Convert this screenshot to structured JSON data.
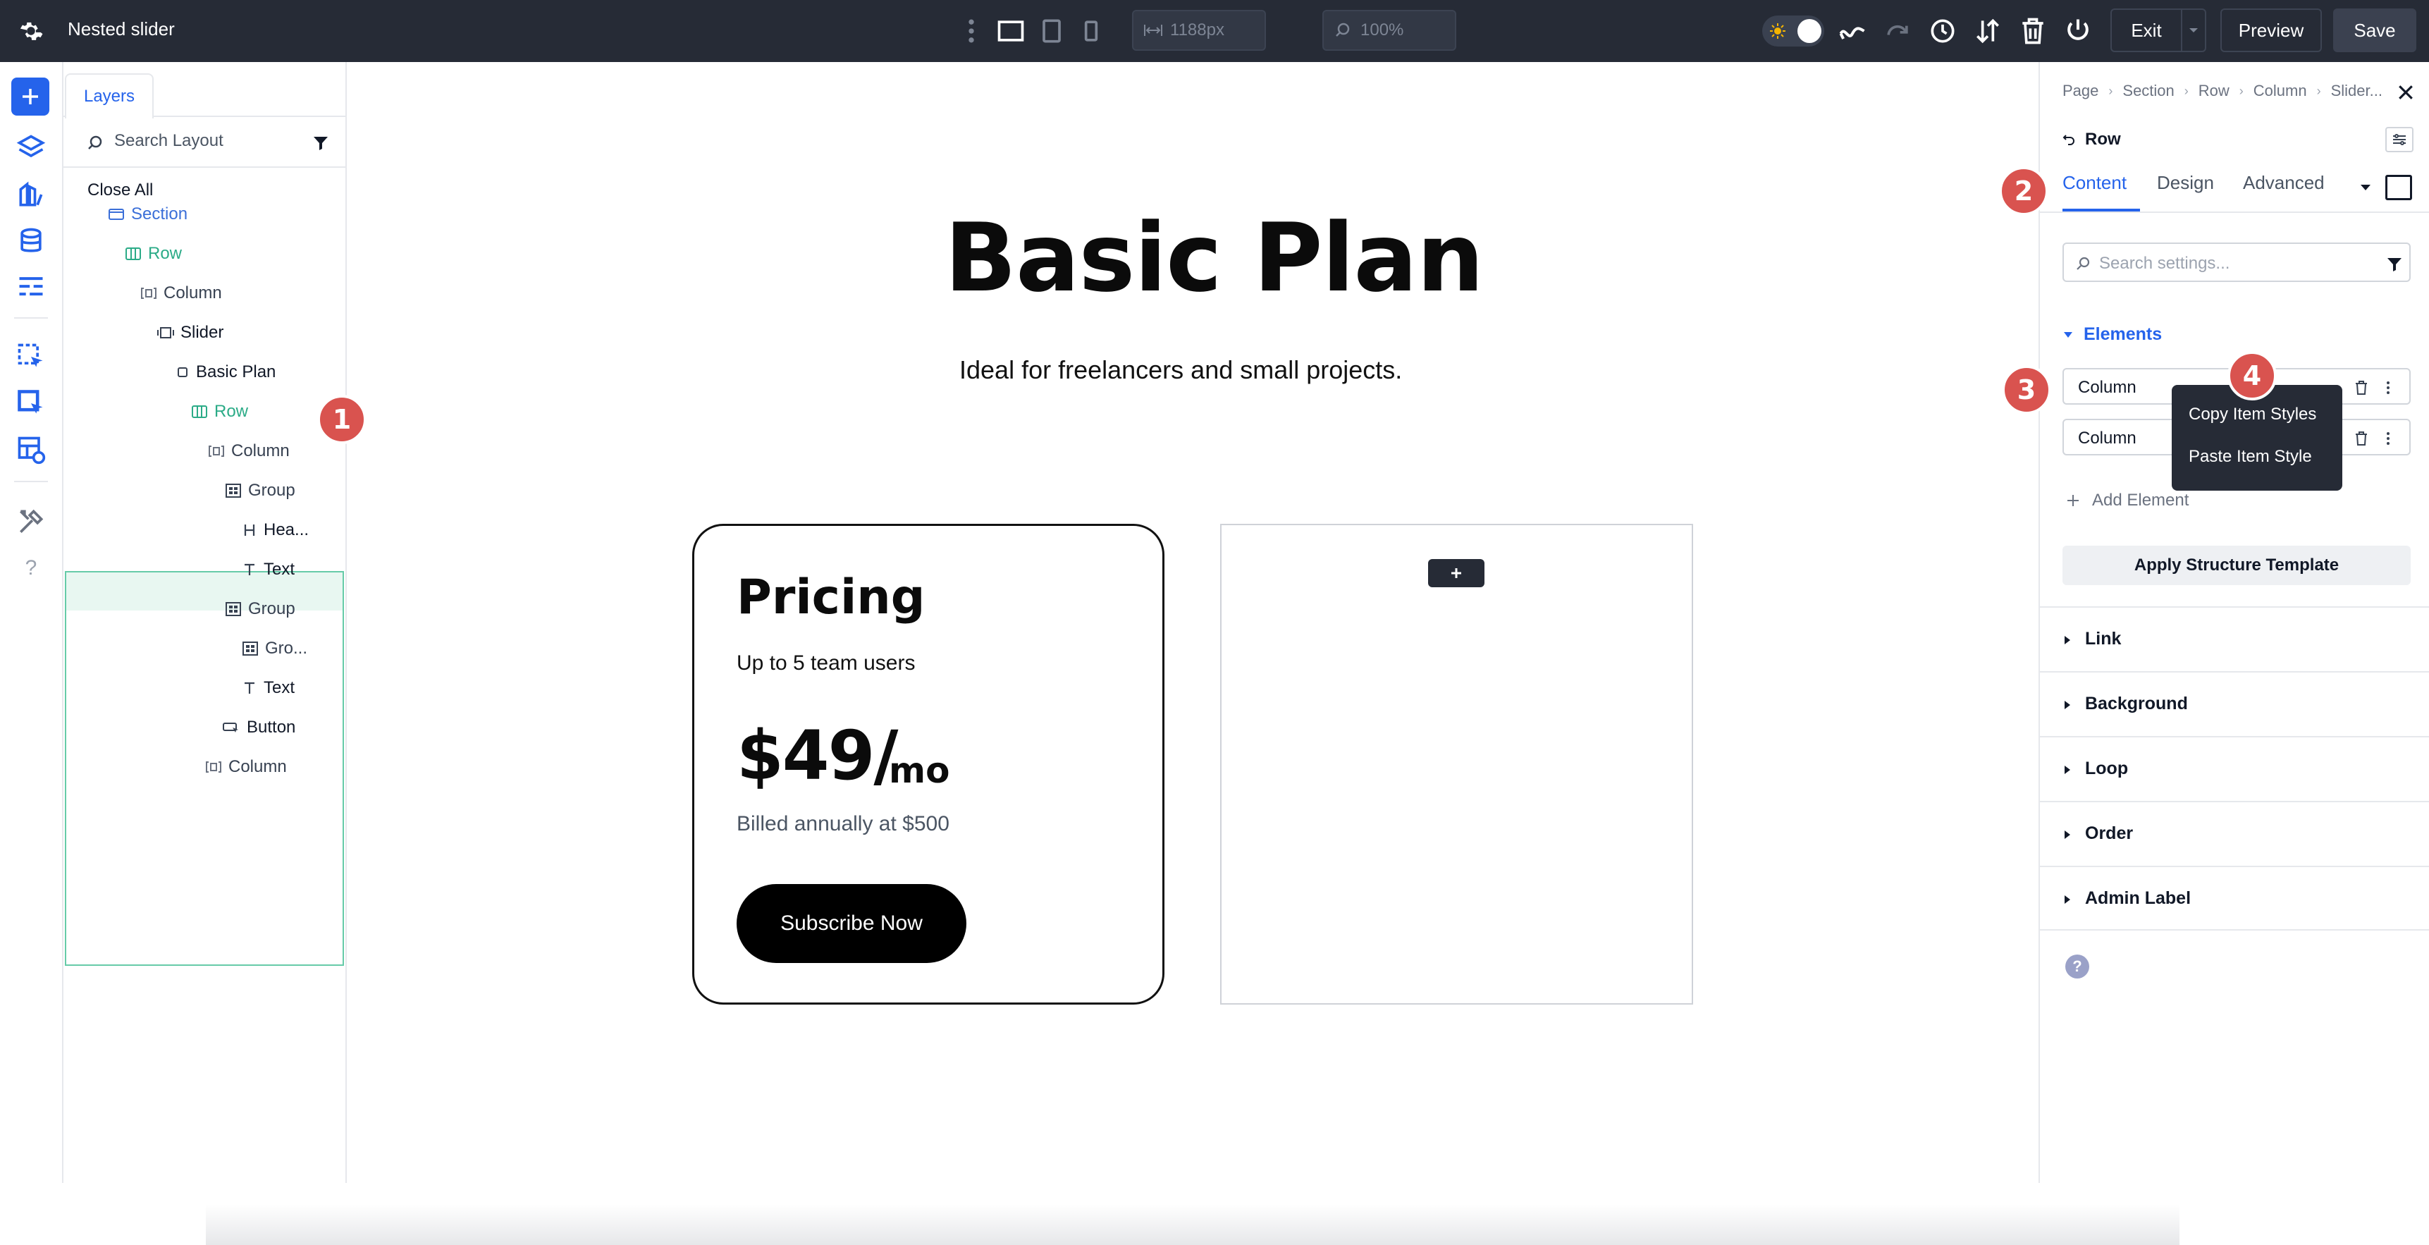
{
  "topbar": {
    "title": "Nested slider",
    "width_field": "1188px",
    "zoom_field": "100%",
    "exit_label": "Exit",
    "preview_label": "Preview",
    "save_label": "Save"
  },
  "layers": {
    "tab_label": "Layers",
    "search_placeholder": "Search Layout",
    "close_all": "Close All",
    "tree": [
      {
        "label": "Section",
        "icon": "section-icon"
      },
      {
        "label": "Row",
        "icon": "row-icon"
      },
      {
        "label": "Column",
        "icon": "column-icon"
      },
      {
        "label": "Slider",
        "icon": "slider-icon"
      },
      {
        "label": "Basic Plan",
        "icon": "slide-icon"
      },
      {
        "label": "Row",
        "icon": "row-icon"
      },
      {
        "label": "Column",
        "icon": "column-icon"
      },
      {
        "label": "Group",
        "icon": "group-icon"
      },
      {
        "label": "Hea...",
        "icon": "heading-icon"
      },
      {
        "label": "Text",
        "icon": "text-icon"
      },
      {
        "label": "Group",
        "icon": "group-icon"
      },
      {
        "label": "Gro...",
        "icon": "group-icon"
      },
      {
        "label": "Text",
        "icon": "text-icon"
      },
      {
        "label": "Button",
        "icon": "button-icon"
      },
      {
        "label": "Column",
        "icon": "column-icon"
      }
    ]
  },
  "canvas": {
    "title": "Basic Plan",
    "subtitle": "Ideal for freelancers and small projects.",
    "card": {
      "title": "Pricing",
      "users": "Up to 5 team users",
      "price": "$49/",
      "period": "mo",
      "billed": "Billed annually at $500",
      "button": "Subscribe Now"
    }
  },
  "settings": {
    "breadcrumb": [
      "Page",
      "Section",
      "Row",
      "Column",
      "Slider..."
    ],
    "back_label": "Row",
    "tabs": [
      "Content",
      "Design",
      "Advanced"
    ],
    "search_placeholder": "Search settings...",
    "elements_heading": "Elements",
    "elements": [
      "Column",
      "Column"
    ],
    "add_element": "Add Element",
    "apply_template": "Apply Structure Template",
    "sections": [
      "Link",
      "Background",
      "Loop",
      "Order",
      "Admin Label"
    ],
    "help": "?"
  },
  "context_menu": {
    "items": [
      "Copy Item Styles",
      "Paste Item Style"
    ]
  },
  "badges": [
    "1",
    "2",
    "3",
    "4"
  ],
  "colors": {
    "topbar": "#262b36",
    "accent_blue": "#2563eb",
    "row_green": "#2bab87",
    "badge_red": "#d9534f"
  }
}
